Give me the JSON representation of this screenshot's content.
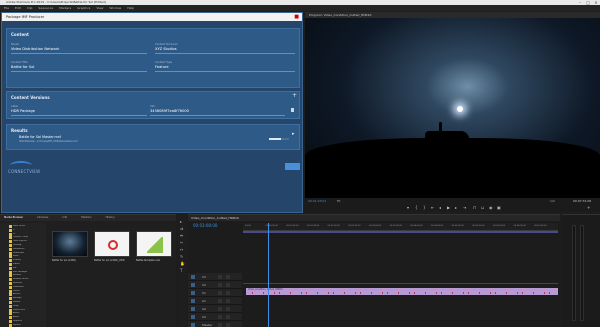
{
  "window": {
    "title": "Adobe Premiere Pro 2019 - C:\\Users\\Projects\\Battle for Sol [Edited]",
    "menu": [
      "File",
      "Edit",
      "Clip",
      "Sequence",
      "Markers",
      "Graphics",
      "View",
      "Window",
      "Help"
    ]
  },
  "dialog": {
    "title": "Package IMF Producer",
    "content": {
      "heading": "Content",
      "studio_label": "Studio",
      "studio_value": "Video Distribution Network",
      "producer_label": "Content Producer",
      "producer_value": "XYZ Studios",
      "title_label": "Content Title",
      "title_value": "Battle for Sol",
      "type_label": "Content Type",
      "type_value": "Feature"
    },
    "versions": {
      "heading": "Content Versions",
      "label_label": "Label",
      "label_value": "HDR Package",
      "uid_label": "UID",
      "uid_value": "3456089f7ea8f76000"
    },
    "results": {
      "heading": "Results",
      "file_name": "Battle for Sol Master.mxf",
      "file_path": "HDR Materials - In Process/IMF_HDR/Deliverables.mxf",
      "progress": 0.6
    },
    "logo_text": "CONNECTVIEW",
    "done_label": ""
  },
  "program": {
    "tab": "Program: Video_Condition_Cutted_HDR10",
    "timecode_left": "00:01:03:01",
    "fit": "Fit",
    "timecode_right": "00:07:31:05",
    "quality": "1/2"
  },
  "project": {
    "tabs": [
      "Media Browser",
      "Libraries",
      "Info",
      "Markers",
      "History"
    ],
    "folders": [
      "Local Drives",
      "C:",
      "D:",
      "Creative Cloud",
      "Team Projects",
      "Desktop",
      "Documents",
      "Downloads",
      "Music",
      "Pictures",
      "Videos",
      "IMF",
      "MXF Packages",
      "Renders",
      "Network Drives",
      "Favorites",
      "Production",
      "Dailies",
      "Archive",
      "Backups",
      "Shared",
      "Temp",
      "Project Files",
      "Assets",
      "Audio",
      "Graphics",
      "Exports"
    ],
    "items": [
      {
        "label": "Battle for sol (2160)",
        "kind": "video"
      },
      {
        "label": "Battle for sol (2160)_HDR",
        "kind": "pdf"
      },
      {
        "label": "Battle-template.xlsx",
        "kind": "sheet"
      }
    ]
  },
  "timeline": {
    "tab": "Video_Condition_Cutted_HDR10",
    "timecode": "00:03:08:00",
    "ticks": [
      "00:00",
      "00:00:30:00",
      "00:01:00:00",
      "00:01:30:00",
      "00:02:00:00",
      "00:02:30:00",
      "00:03:00:00",
      "00:03:30:00",
      "00:04:00:00",
      "00:04:30:00",
      "00:05:00:00",
      "00:05:30:00",
      "00:06:00:00",
      "00:06:30:00",
      "00:07:00:00"
    ],
    "tracks": [
      "V3",
      "V2",
      "V1",
      "A1",
      "A2",
      "A3",
      "Master"
    ],
    "clip_label": "Video_Condition_Cutted_HDR10"
  }
}
